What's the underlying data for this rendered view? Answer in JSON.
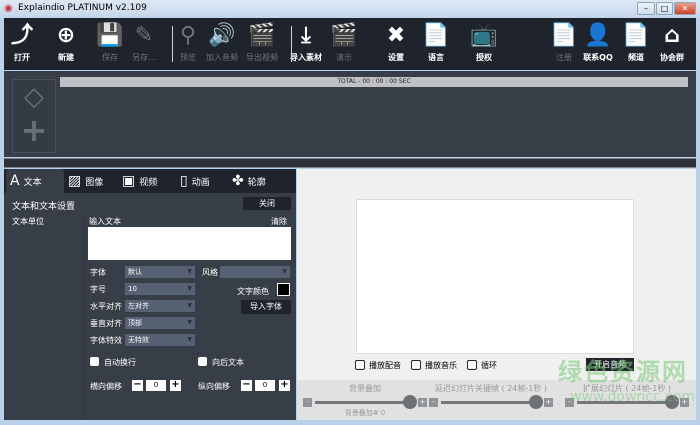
{
  "window": {
    "title": "Explaindio PLATINUM v2.109",
    "minimize": "–",
    "maximize": "□",
    "close": "✕"
  },
  "toolbar": [
    {
      "label": "打开",
      "icon": "open-file-icon",
      "glyph": "⤴",
      "enabled": true
    },
    {
      "label": "新建",
      "icon": "new-file-icon",
      "glyph": "⊕",
      "enabled": true
    },
    {
      "label": "保存",
      "icon": "save-icon",
      "glyph": "💾",
      "enabled": false
    },
    {
      "label": "另存...",
      "icon": "save-as-icon",
      "glyph": "✎",
      "enabled": false
    },
    {
      "label": "预览",
      "icon": "search-icon",
      "glyph": "⚲",
      "enabled": false
    },
    {
      "label": "加入音频",
      "icon": "speaker-icon",
      "glyph": "🔊",
      "enabled": false
    },
    {
      "label": "导出视频",
      "icon": "clapper-icon",
      "glyph": "🎬",
      "enabled": false
    },
    {
      "label": "导入素材",
      "icon": "download-icon",
      "glyph": "⤓",
      "enabled": true
    },
    {
      "label": "演示",
      "icon": "clapper-icon",
      "glyph": "🎬",
      "enabled": false
    },
    {
      "label": "设置",
      "icon": "tools-icon",
      "glyph": "✖",
      "enabled": true
    },
    {
      "label": "语言",
      "icon": "certificate-icon",
      "glyph": "📄",
      "enabled": true
    },
    {
      "label": "授权",
      "icon": "tv-icon",
      "glyph": "📺",
      "enabled": true
    },
    {
      "label": "注册",
      "icon": "certificate-icon",
      "glyph": "📄",
      "enabled": false
    },
    {
      "label": "联系QQ",
      "icon": "user-icon",
      "glyph": "👤",
      "enabled": true
    },
    {
      "label": "频道",
      "icon": "certificate-icon",
      "glyph": "📄",
      "enabled": true
    },
    {
      "label": "协会群",
      "icon": "home-icon",
      "glyph": "⌂",
      "enabled": true
    }
  ],
  "timeline": {
    "total": "TOTAL - 00 : 00 : 00 SEC"
  },
  "tabs": [
    {
      "label": "文本",
      "glyph": "A"
    },
    {
      "label": "图像",
      "glyph": "▨"
    },
    {
      "label": "视频",
      "glyph": "▣"
    },
    {
      "label": "动画",
      "glyph": "▯"
    },
    {
      "label": "轮廓",
      "glyph": "✤"
    }
  ],
  "text_panel": {
    "title": "文本和文本设置",
    "close": "关闭",
    "units": "文本单位",
    "input_label": "输入文本",
    "clear": "清除",
    "input_value": "",
    "font_label": "字体",
    "font_value": "默认",
    "style_label": "风格",
    "style_value": "",
    "size_label": "字号",
    "size_value": "10",
    "color_label": "文字颜色",
    "text_color": "#000000",
    "halign_label": "水平对齐",
    "halign_value": "左对齐",
    "import_font": "导入字体",
    "valign_label": "垂直对齐",
    "valign_value": "顶部",
    "effect_label": "字体特效",
    "effect_value": "无特效",
    "autowrap": "自动换行",
    "backward": "向后文本",
    "hoffset_label": "横向偏移",
    "hoffset": "0",
    "voffset_label": "纵向偏移",
    "voffset": "0"
  },
  "preview": {
    "play_voice": "播放配音",
    "play_music": "播放音乐",
    "loop": "循环",
    "open_audio": "开启音频"
  },
  "sliders": [
    {
      "label": "背景叠加",
      "value_text": "背景叠加# 0",
      "fraction": 0.95
    },
    {
      "label": "延迟幻灯片关键帧 ( 24帧-1秒 )",
      "fraction": 0.95
    },
    {
      "label": "扩展幻灯片 ( 24帧-1秒 )",
      "fraction": 0.95
    }
  ],
  "watermark": {
    "cn": "绿色资源网",
    "url": "www.downcc.com"
  }
}
